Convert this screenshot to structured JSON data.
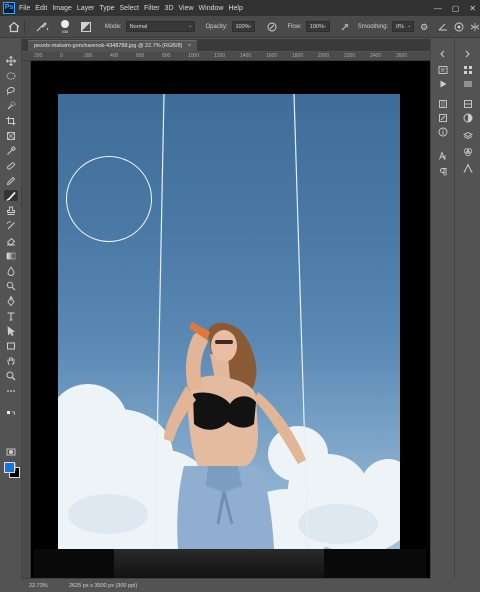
{
  "app": {
    "name": "Adobe Photoshop",
    "logo_text": "Ps"
  },
  "menu": [
    "File",
    "Edit",
    "Image",
    "Layer",
    "Type",
    "Select",
    "Filter",
    "3D",
    "View",
    "Window",
    "Help"
  ],
  "window_controls": {
    "minimize": "—",
    "maximize": "▢",
    "close": "✕"
  },
  "options_bar": {
    "brush_size": "438",
    "mode_label": "Mode:",
    "mode_value": "Normal",
    "opacity_label": "Opacity:",
    "opacity_value": "100%",
    "flow_label": "Flow:",
    "flow_value": "100%",
    "smoothing_label": "Smoothing:",
    "smoothing_value": "0%"
  },
  "document": {
    "tab_title": "pexels-maksim-goncharenok-4348788.jpg @ 22.7% (RGB/8)",
    "tab_close": "×"
  },
  "ruler": {
    "ticks": [
      "200",
      "0",
      "200",
      "400",
      "600",
      "800",
      "1000",
      "1200",
      "1400",
      "1600",
      "1800",
      "2000",
      "2200",
      "2400",
      "2600"
    ]
  },
  "status": {
    "zoom": "22.73%",
    "doc_size": "2625 px x 3500 px (300 ppi)"
  },
  "colors": {
    "foreground": "#1473e6",
    "background": "#000000",
    "app_bg": "#535353",
    "menubar_bg": "#323232"
  },
  "tools": [
    "move-tool",
    "marquee-tool",
    "lasso-tool",
    "quick-select-tool",
    "crop-tool",
    "eyedropper-tool",
    "healing-brush-tool",
    "brush-tool",
    "clone-stamp-tool",
    "history-brush-tool",
    "eraser-tool",
    "gradient-tool",
    "blur-tool",
    "dodge-tool",
    "pen-tool",
    "type-tool",
    "path-select-tool",
    "rectangle-tool",
    "hand-tool",
    "zoom-tool",
    "more-tools"
  ]
}
